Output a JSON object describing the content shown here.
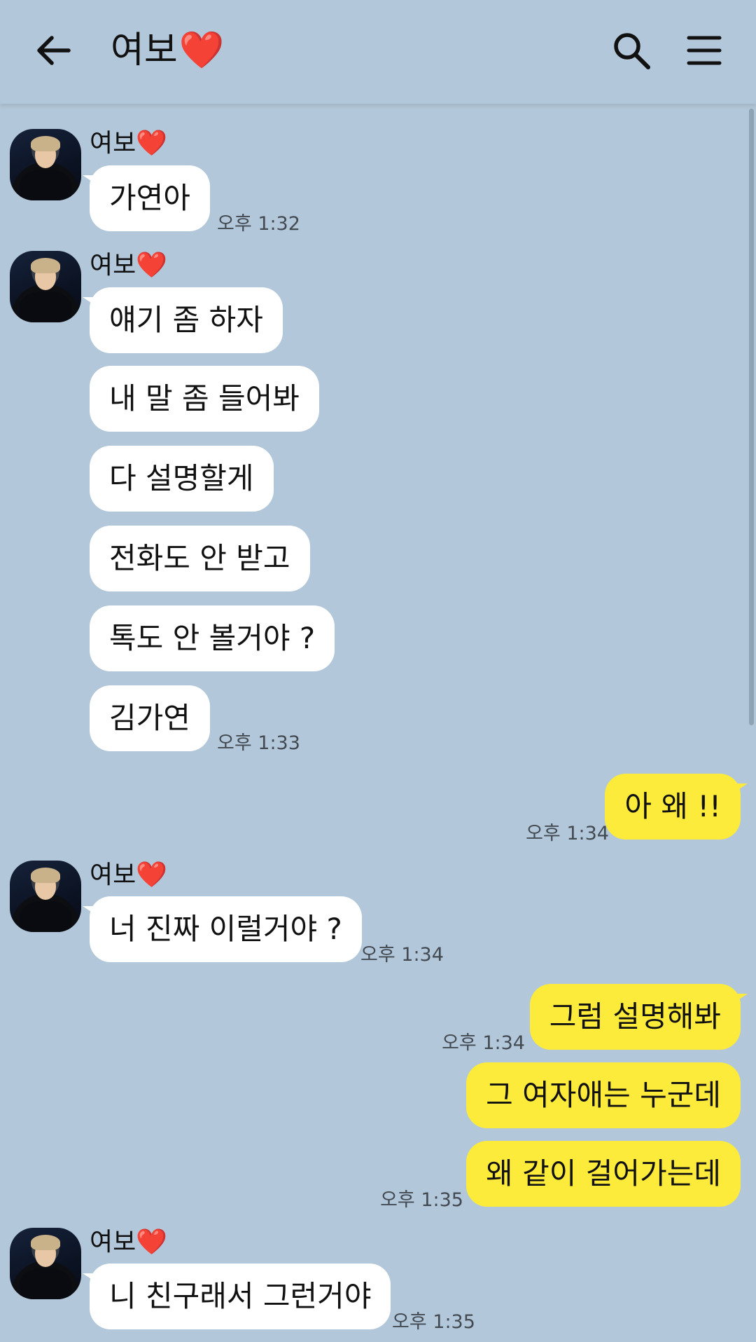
{
  "header": {
    "title": "여보",
    "title_emoji": "❤️"
  },
  "colors": {
    "background": "#b2c7d9",
    "incoming_bubble": "#ffffff",
    "outgoing_bubble": "#fdeb3c"
  },
  "messages": [
    {
      "sender": "여보❤️",
      "text": "가연아",
      "time": "오후 1:32"
    },
    {
      "sender": "여보❤️",
      "text": "얘기 좀 하자"
    },
    {
      "text": "내 말 좀 들어봐"
    },
    {
      "text": "다 설명할게"
    },
    {
      "text": "전화도 안 받고"
    },
    {
      "text": "톡도 안 볼거야 ?"
    },
    {
      "text": "김가연",
      "time": "오후 1:33"
    },
    {
      "text": "아 왜 !!",
      "time": "오후 1:34"
    },
    {
      "sender": "여보❤️",
      "text": "너 진짜 이럴거야 ?",
      "time": "오후 1:34"
    },
    {
      "text": "그럼 설명해봐",
      "time": "오후 1:34"
    },
    {
      "text": "그 여자애는 누군데"
    },
    {
      "text": "왜 같이 걸어가는데",
      "time": "오후 1:35"
    },
    {
      "sender": "여보❤️",
      "text": "니 친구래서 그런거야",
      "time": "오후 1:35"
    }
  ]
}
